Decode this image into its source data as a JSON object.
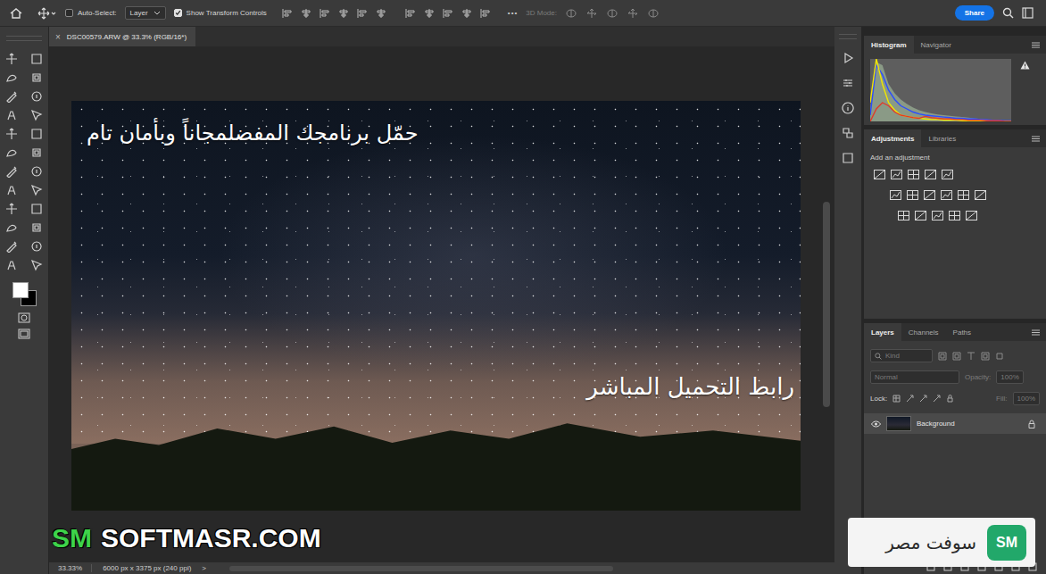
{
  "optionsBar": {
    "autoSelect": {
      "label": "Auto-Select:",
      "checked": false
    },
    "targetDropdown": {
      "value": "Layer"
    },
    "transformControls": {
      "label": "Show Transform Controls",
      "checked": true
    },
    "moreGlyph": "•••",
    "mode3d": {
      "label": "3D Mode:",
      "disabled": true
    },
    "shareButton": "Share"
  },
  "document": {
    "closeGlyph": "×",
    "tab": "DSC00579.ARW @ 33.3% (RGB/16*)"
  },
  "promo": {
    "headline": "حمّل برنامجك المفضلمجاناً وبأمان تام",
    "link": "رابط التحميل المباشر"
  },
  "statusBar": {
    "zoom": "33.33%",
    "info": "6000 px x 3375 px (240 ppi)",
    "arrow": ">"
  },
  "histogramPanel": {
    "tabs": [
      {
        "label": "Histogram",
        "selected": true
      },
      {
        "label": "Navigator",
        "selected": false
      }
    ],
    "series": [
      {
        "kind": "area",
        "color": "#8a9a86",
        "values": [
          0.2,
          0.95,
          0.9,
          0.6,
          0.45,
          0.35,
          0.28,
          0.22,
          0.18,
          0.15,
          0.13,
          0.11,
          0.1,
          0.09,
          0.08,
          0.07,
          0.06,
          0.05,
          0.04,
          0.03,
          0.02,
          0.02,
          0.01,
          0.01
        ]
      },
      {
        "kind": "line",
        "color": "#2b4cff",
        "values": [
          0.1,
          0.9,
          0.75,
          0.5,
          0.35,
          0.25,
          0.2,
          0.15,
          0.12,
          0.1,
          0.09,
          0.08,
          0.07,
          0.06,
          0.05,
          0.05,
          0.04,
          0.04,
          0.03,
          0.03,
          0.02,
          0.02,
          0.01,
          0.01
        ]
      },
      {
        "kind": "line",
        "color": "#f2e600",
        "values": [
          0.3,
          1.0,
          0.6,
          0.3,
          0.18,
          0.1,
          0.08,
          0.06,
          0.05,
          0.04,
          0.03,
          0.03,
          0.02,
          0.02,
          0.02,
          0.01,
          0.01,
          0.01,
          0.01,
          0.0,
          0.0,
          0.0,
          0.0,
          0.0
        ]
      },
      {
        "kind": "line",
        "color": "#e03a2a",
        "values": [
          0.0,
          0.2,
          0.3,
          0.25,
          0.15,
          0.1,
          0.08,
          0.06,
          0.05,
          0.08,
          0.06,
          0.05,
          0.04,
          0.04,
          0.03,
          0.03,
          0.02,
          0.02,
          0.02,
          0.01,
          0.01,
          0.01,
          0.0,
          0.0
        ]
      }
    ]
  },
  "adjustmentsPanel": {
    "tabs": [
      {
        "label": "Adjustments",
        "selected": true
      },
      {
        "label": "Libraries",
        "selected": false
      }
    ],
    "hint": "Add an adjustment"
  },
  "layersPanel": {
    "tabs": [
      {
        "label": "Layers",
        "selected": true
      },
      {
        "label": "Channels",
        "selected": false
      },
      {
        "label": "Paths",
        "selected": false
      }
    ],
    "filter": {
      "placeholder": "Kind"
    },
    "blendMode": {
      "value": "Normal",
      "disabled": true
    },
    "opacity": {
      "label": "Opacity:",
      "value": "100%",
      "disabled": true
    },
    "lock": {
      "label": "Lock:"
    },
    "fill": {
      "label": "Fill:",
      "value": "100%",
      "disabled": true
    },
    "layers": [
      {
        "name": "Background",
        "visible": true,
        "locked": true,
        "selected": true
      }
    ]
  },
  "watermarks": {
    "site": {
      "badge": "SM",
      "text": "SOFTMASR.COM"
    },
    "brand": {
      "text": "سوفت مصر",
      "badge": "SM"
    }
  }
}
